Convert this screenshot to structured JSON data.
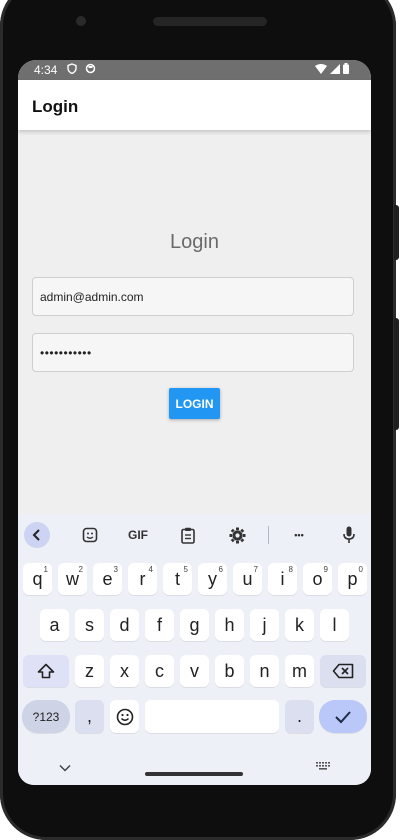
{
  "status_bar": {
    "time": "4:34"
  },
  "app_bar": {
    "title": "Login"
  },
  "login_form": {
    "heading": "Login",
    "email_value": "admin@admin.com",
    "password_value": "•••••••••••",
    "login_button": "LOGIN"
  },
  "colors": {
    "accent": "#2196f3",
    "status_bar": "#6f6f6f",
    "keyboard_bg": "#eef0f8"
  },
  "keyboard": {
    "toolbar": {
      "gif": "GIF",
      "more": "•••"
    },
    "row1": [
      {
        "k": "q",
        "h": "1"
      },
      {
        "k": "w",
        "h": "2"
      },
      {
        "k": "e",
        "h": "3"
      },
      {
        "k": "r",
        "h": "4"
      },
      {
        "k": "t",
        "h": "5"
      },
      {
        "k": "y",
        "h": "6"
      },
      {
        "k": "u",
        "h": "7"
      },
      {
        "k": "i",
        "h": "8"
      },
      {
        "k": "o",
        "h": "9"
      },
      {
        "k": "p",
        "h": "0"
      }
    ],
    "row2": [
      "a",
      "s",
      "d",
      "f",
      "g",
      "h",
      "j",
      "k",
      "l"
    ],
    "row3": [
      "z",
      "x",
      "c",
      "v",
      "b",
      "n",
      "m"
    ],
    "num_key": "?123",
    "comma": ",",
    "period": "."
  }
}
